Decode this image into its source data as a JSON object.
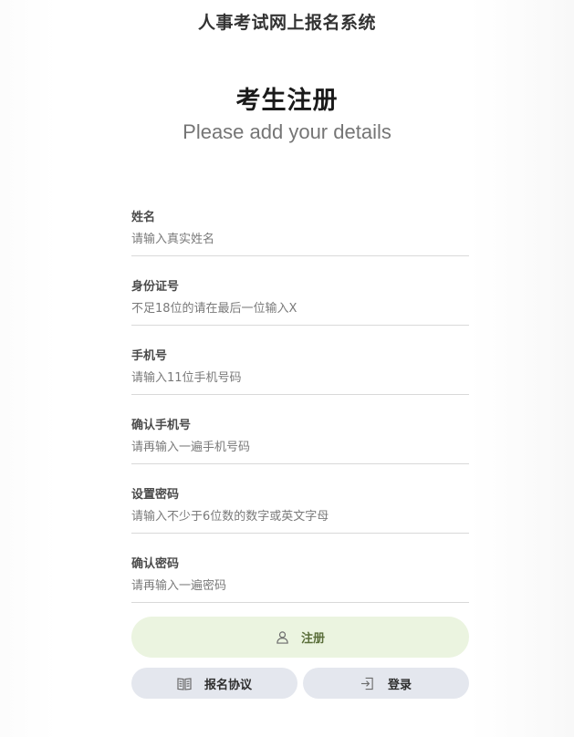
{
  "app": {
    "title": "人事考试网上报名系统"
  },
  "form": {
    "heading": "考生注册",
    "subheading": "Please add your details",
    "fields": [
      {
        "label": "姓名",
        "placeholder": "请输入真实姓名",
        "value": ""
      },
      {
        "label": "身份证号",
        "placeholder": "不足18位的请在最后一位输入X",
        "value": ""
      },
      {
        "label": "手机号",
        "placeholder": "请输入11位手机号码",
        "value": ""
      },
      {
        "label": "确认手机号",
        "placeholder": "请再输入一遍手机号码",
        "value": ""
      },
      {
        "label": "设置密码",
        "placeholder": "请输入不少于6位数的数字或英文字母",
        "value": ""
      },
      {
        "label": "确认密码",
        "placeholder": "请再输入一遍密码",
        "value": ""
      }
    ]
  },
  "actions": {
    "register": {
      "label": "注册",
      "icon": "user-icon",
      "bg_color": "#ebf4e0"
    },
    "agreement": {
      "label": "报名协议",
      "icon": "book-icon",
      "bg_color": "#e4e7ee"
    },
    "login": {
      "label": "登录",
      "icon": "login-icon",
      "bg_color": "#e4e7ee"
    }
  }
}
